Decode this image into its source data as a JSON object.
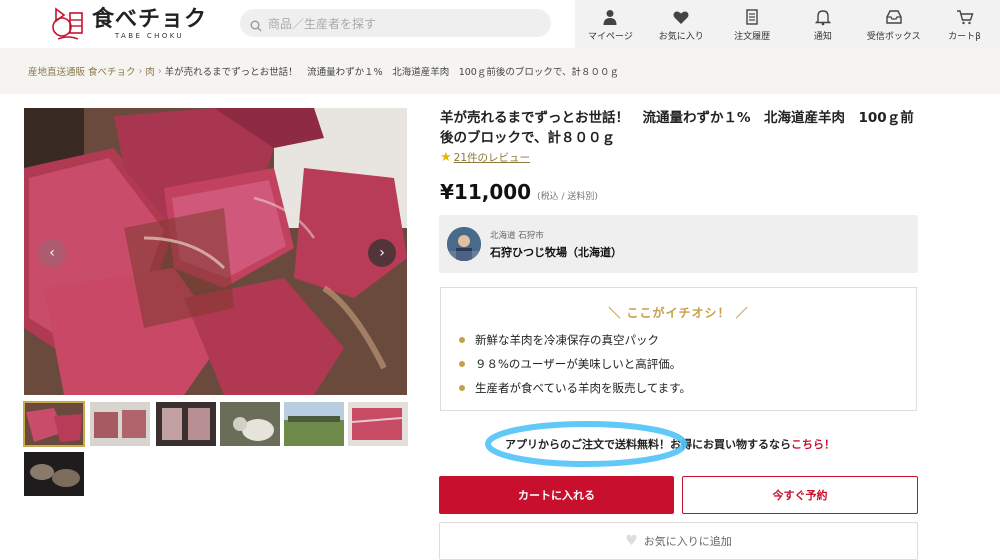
{
  "header": {
    "logo_text": "食べチョク",
    "logo_sub": "TABE CHOKU",
    "search_placeholder": "商品／生産者を探す",
    "nav": [
      {
        "label": "マイページ",
        "icon": "user-icon"
      },
      {
        "label": "お気に入り",
        "icon": "heart-icon"
      },
      {
        "label": "注文履歴",
        "icon": "receipt-icon"
      },
      {
        "label": "通知",
        "icon": "bell-icon"
      },
      {
        "label": "受信ボックス",
        "icon": "inbox-icon"
      },
      {
        "label": "カートβ",
        "icon": "cart-icon"
      }
    ]
  },
  "breadcrumb": {
    "items": [
      "産地直送通販 食べチョク",
      "肉",
      "羊が売れるまでずっとお世話！　流通量わずか１%　北海道産羊肉　100ｇ前後のブロックで、計８００ｇ"
    ],
    "separator": "›"
  },
  "product": {
    "title": "羊が売れるまでずっとお世話！　流通量わずか１%　北海道産羊肉　100ｇ前後のブロックで、計８００ｇ",
    "reviews": "21件のレビュー",
    "price": "¥11,000",
    "price_note": "(税込 / 送料別)",
    "producer_region": "北海道 石狩市",
    "producer_name": "石狩ひつじ牧場（北海道）"
  },
  "points": {
    "title": "＼ ここがイチオシ！ ／",
    "items": [
      "新鮮な羊肉を冷凍保存の真空パック",
      "９８%のユーザーが美味しいと高評価。",
      "生産者が食べている羊肉を販売してます。"
    ]
  },
  "app_promo": {
    "text": "アプリからのご注文で送料無料！お得にお買い物するなら",
    "link": "こちら！"
  },
  "buttons": {
    "cart": "カートに入れる",
    "reserve": "今すぐ予約",
    "favorite": "お気に入りに追加"
  },
  "colors": {
    "accent": "#c8102e",
    "gold": "#c8a04b",
    "highlight": "#4fc3f7"
  }
}
